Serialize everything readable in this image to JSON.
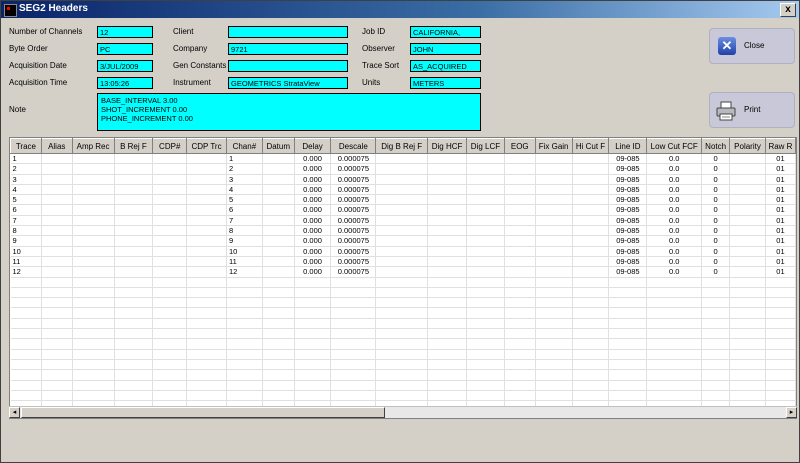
{
  "window": {
    "title": "SEG2 Headers",
    "close_glyph": "x"
  },
  "header": {
    "number_of_channels": {
      "label": "Number of Channels",
      "value": "12"
    },
    "byte_order": {
      "label": "Byte Order",
      "value": "PC"
    },
    "acquisition_date": {
      "label": "Acquisition Date",
      "value": "3/JUL/2009"
    },
    "acquisition_time": {
      "label": "Acquisition Time",
      "value": "13:05:26"
    },
    "client": {
      "label": "Client",
      "value": ""
    },
    "company": {
      "label": "Company",
      "value": "9721"
    },
    "gen_constants": {
      "label": "Gen Constants",
      "value": ""
    },
    "instrument": {
      "label": "Instrument",
      "value": "GEOMETRICS StrataView"
    },
    "job_id": {
      "label": "Job ID",
      "value": "CALIFORNIA,"
    },
    "observer": {
      "label": "Observer",
      "value": "JOHN"
    },
    "trace_sort": {
      "label": "Trace Sort",
      "value": "AS_ACQUIRED"
    },
    "units": {
      "label": "Units",
      "value": "METERS"
    },
    "note": {
      "label": "Note",
      "lines": [
        "BASE_INTERVAL 3.00",
        "SHOT_INCREMENT 0.00",
        "PHONE_INCREMENT 0.00"
      ]
    }
  },
  "buttons": {
    "close": "Close",
    "print": "Print"
  },
  "table": {
    "columns": [
      "Trace",
      "Alias",
      "Amp Rec",
      "B Rej F",
      "CDP#",
      "CDP Trc",
      "Chan#",
      "Datum",
      "Delay",
      "Descale",
      "Dig B Rej F",
      "Dig HCF",
      "Dig LCF",
      "EOG",
      "Fix Gain",
      "Hi Cut F",
      "Line ID",
      "Low Cut FCF",
      "Notch",
      "Polarity",
      "Raw R"
    ],
    "rows": [
      [
        "1",
        "",
        "",
        "",
        "",
        "",
        "1",
        "",
        "0.000",
        "0.000075",
        "",
        "",
        "",
        "",
        "",
        "",
        "09-085",
        "0.0",
        "0",
        "",
        "01"
      ],
      [
        "2",
        "",
        "",
        "",
        "",
        "",
        "2",
        "",
        "0.000",
        "0.000075",
        "",
        "",
        "",
        "",
        "",
        "",
        "09-085",
        "0.0",
        "0",
        "",
        "01"
      ],
      [
        "3",
        "",
        "",
        "",
        "",
        "",
        "3",
        "",
        "0.000",
        "0.000075",
        "",
        "",
        "",
        "",
        "",
        "",
        "09-085",
        "0.0",
        "0",
        "",
        "01"
      ],
      [
        "4",
        "",
        "",
        "",
        "",
        "",
        "4",
        "",
        "0.000",
        "0.000075",
        "",
        "",
        "",
        "",
        "",
        "",
        "09-085",
        "0.0",
        "0",
        "",
        "01"
      ],
      [
        "5",
        "",
        "",
        "",
        "",
        "",
        "5",
        "",
        "0.000",
        "0.000075",
        "",
        "",
        "",
        "",
        "",
        "",
        "09-085",
        "0.0",
        "0",
        "",
        "01"
      ],
      [
        "6",
        "",
        "",
        "",
        "",
        "",
        "6",
        "",
        "0.000",
        "0.000075",
        "",
        "",
        "",
        "",
        "",
        "",
        "09-085",
        "0.0",
        "0",
        "",
        "01"
      ],
      [
        "7",
        "",
        "",
        "",
        "",
        "",
        "7",
        "",
        "0.000",
        "0.000075",
        "",
        "",
        "",
        "",
        "",
        "",
        "09-085",
        "0.0",
        "0",
        "",
        "01"
      ],
      [
        "8",
        "",
        "",
        "",
        "",
        "",
        "8",
        "",
        "0.000",
        "0.000075",
        "",
        "",
        "",
        "",
        "",
        "",
        "09-085",
        "0.0",
        "0",
        "",
        "01"
      ],
      [
        "9",
        "",
        "",
        "",
        "",
        "",
        "9",
        "",
        "0.000",
        "0.000075",
        "",
        "",
        "",
        "",
        "",
        "",
        "09-085",
        "0.0",
        "0",
        "",
        "01"
      ],
      [
        "10",
        "",
        "",
        "",
        "",
        "",
        "10",
        "",
        "0.000",
        "0.000075",
        "",
        "",
        "",
        "",
        "",
        "",
        "09-085",
        "0.0",
        "0",
        "",
        "01"
      ],
      [
        "11",
        "",
        "",
        "",
        "",
        "",
        "11",
        "",
        "0.000",
        "0.000075",
        "",
        "",
        "",
        "",
        "",
        "",
        "09-085",
        "0.0",
        "0",
        "",
        "01"
      ],
      [
        "12",
        "",
        "",
        "",
        "",
        "",
        "12",
        "",
        "0.000",
        "0.000075",
        "",
        "",
        "",
        "",
        "",
        "",
        "09-085",
        "0.0",
        "0",
        "",
        "01"
      ]
    ],
    "empty_rows": 13
  },
  "colors": {
    "field_bg": "#00ffff",
    "dialog_bg": "#d4d0c8",
    "title_start": "#0a246a"
  }
}
